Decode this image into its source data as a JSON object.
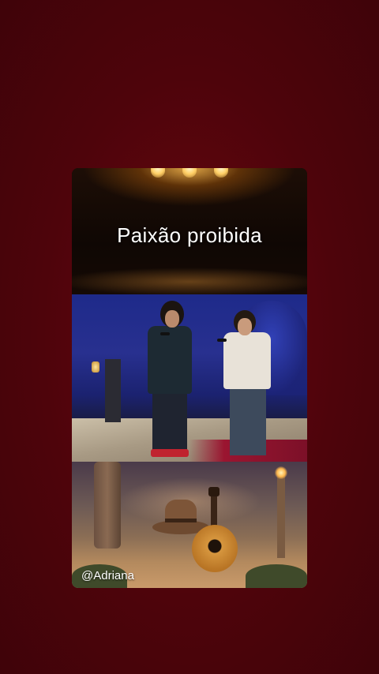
{
  "video": {
    "title": "Paixão proibida",
    "watermark": "@Adriana"
  },
  "colors": {
    "background": "#5a0510",
    "title_text": "#ffffff"
  }
}
